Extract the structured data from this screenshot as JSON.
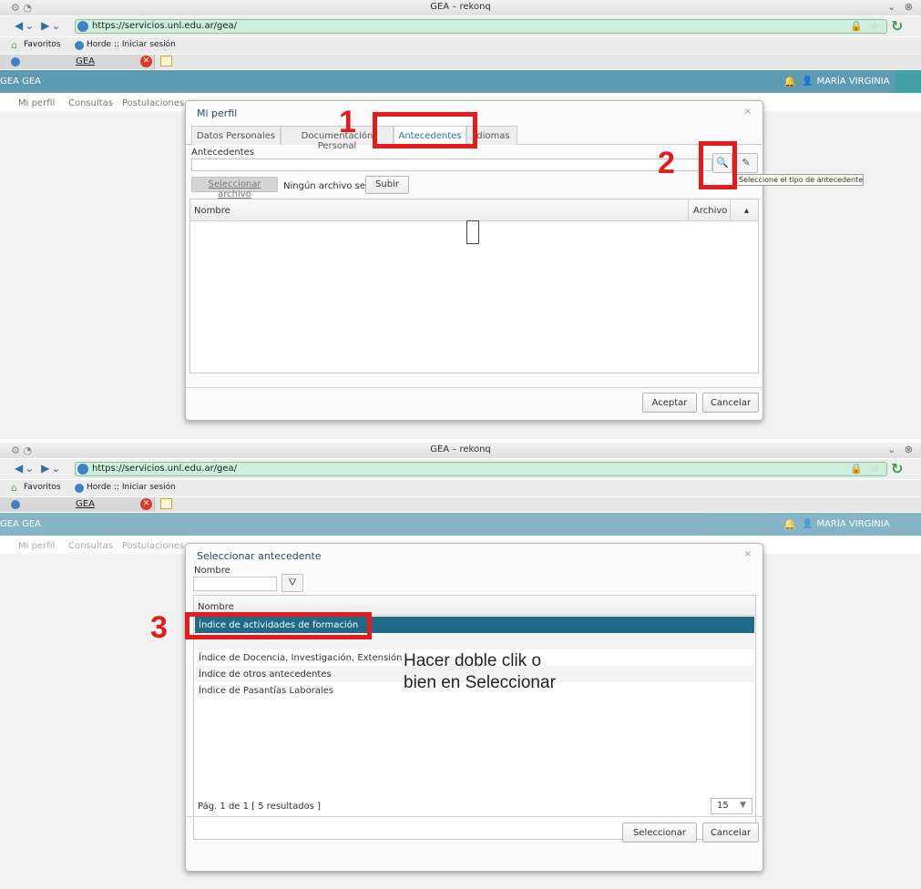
{
  "browser": {
    "window_title": "GEA – rekonq",
    "url": "https://servicios.unl.edu.ar/gea/",
    "bookmarks": [
      "Favoritos",
      "Horde :: Iniciar sesión"
    ],
    "tab_label": "GEA"
  },
  "app": {
    "title": "GEA GEA",
    "user": "MARÍA VIRGINIA",
    "menu": [
      "Mi perfil",
      "Consultas",
      "Postulaciones"
    ]
  },
  "profile_dialog": {
    "title": "Mi perfil",
    "close": "×",
    "tabs": [
      "Datos Personales",
      "Documentación Personal",
      "Antecedentes",
      "Idiomas"
    ],
    "field_label": "Antecedentes",
    "file_button": "Seleccionar archivo",
    "no_file_text": "Ningún archivo sele",
    "upload_button": "Subir",
    "col_name": "Nombre",
    "col_file": "Archivo",
    "sort_indicator": "▴",
    "tooltip": "Seleccione el tipo de antecedente",
    "accept_button": "Aceptar",
    "cancel_button": "Cancelar"
  },
  "select_dialog": {
    "title": "Seleccionar antecedente",
    "close": "×",
    "filter_label": "Nombre",
    "col_name": "Nombre",
    "rows": [
      "Índice de actividades de formación",
      "",
      "Índice de Docencia, Investigación, Extensión",
      "Índice de otros antecedentes",
      "Índice de Pasantías Laborales"
    ],
    "pager_text": "Pág. 1 de 1 [ 5 resultados ]",
    "page_size": "15",
    "select_button": "Seleccionar",
    "cancel_button": "Cancelar"
  },
  "annotations": {
    "step1": "1",
    "step2": "2",
    "step3": "3",
    "hint_line1": "Hacer doble clik o",
    "hint_line2": "bien en Seleccionar"
  },
  "colors": {
    "accent_red": "#e31b1b",
    "app_bar": "#5d9bb3",
    "selected_row": "#1f6a88",
    "url_bar": "#cfeedd"
  }
}
